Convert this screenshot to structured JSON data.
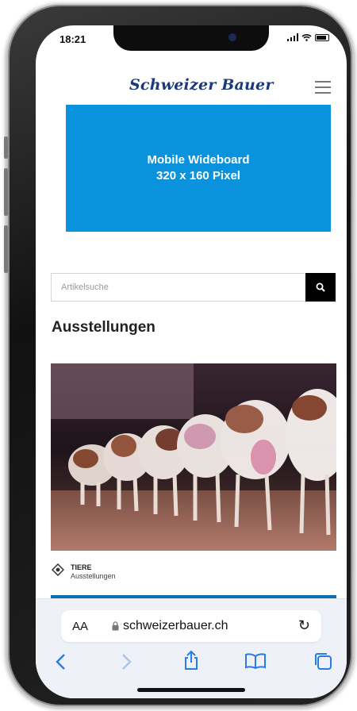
{
  "status_bar": {
    "time": "18:21"
  },
  "site": {
    "logo": "Schweizer Bauer"
  },
  "ad": {
    "line1": "Mobile Wideboard",
    "line2": "320 x 160 Pixel",
    "color": "#0b92dd"
  },
  "search": {
    "placeholder": "Artikelsuche",
    "value": ""
  },
  "section": {
    "title": "Ausstellungen"
  },
  "article": {
    "category": "TIERE",
    "subcategory": "Ausstellungen"
  },
  "browser": {
    "text_size_label": "AA",
    "url": "schweizerbauer.ch"
  },
  "icons": {
    "search": "search-icon",
    "menu": "hamburger-menu-icon",
    "reload": "reload-icon",
    "back": "chevron-left-icon",
    "forward": "chevron-right-icon",
    "share": "share-icon",
    "bookmarks": "book-icon",
    "tabs": "tabs-icon",
    "lock": "lock-icon",
    "category": "category-icon"
  },
  "colors": {
    "brand_blue": "#1a3a7a",
    "safari_blue": "#2a7be4",
    "accent_bar": "#0b6fb0"
  }
}
